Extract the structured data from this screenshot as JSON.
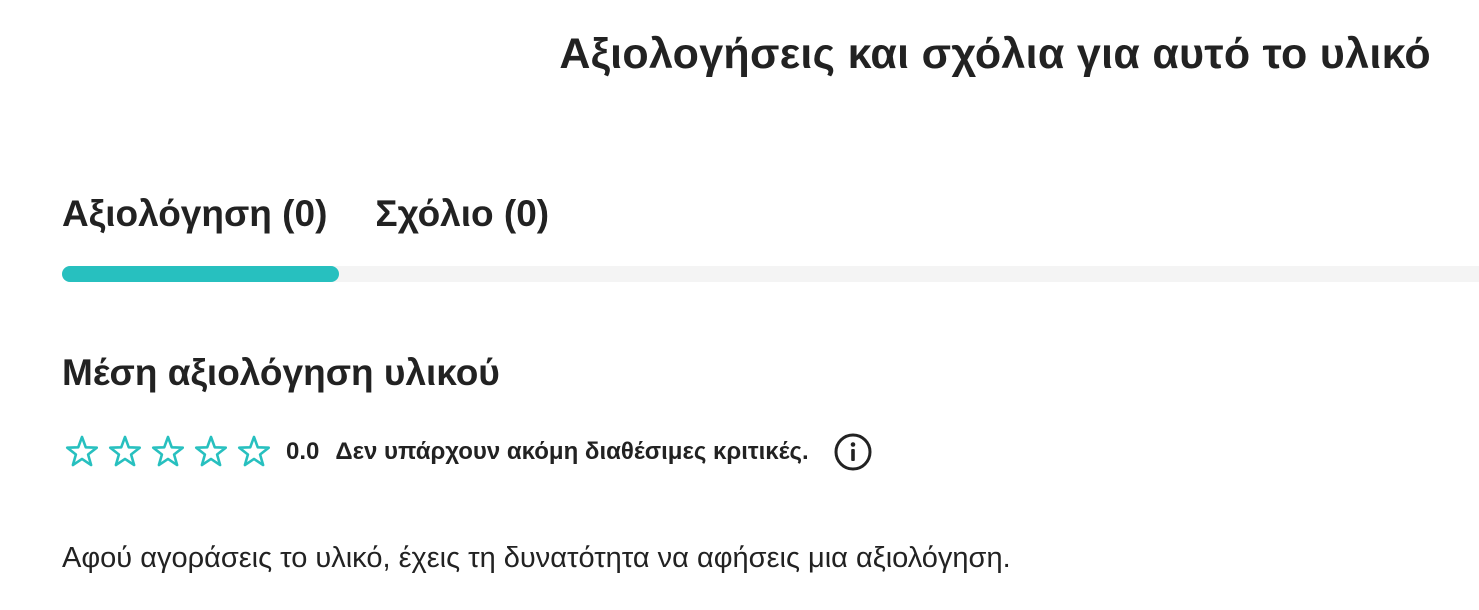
{
  "header": {
    "title": "Αξιολογήσεις και σχόλια για αυτό το υλικό"
  },
  "tabs": [
    {
      "label": "Αξιολόγηση (0)",
      "active": true
    },
    {
      "label": "Σχόλιο (0)",
      "active": false
    }
  ],
  "rating": {
    "section_title": "Μέση αξιολόγηση υλικού",
    "value": "0.0",
    "stars_filled": 0,
    "stars_total": 5,
    "status_text": "Δεν υπάρχουν ακόμη διαθέσιμες κριτικές.",
    "info_icon": "info-icon"
  },
  "notice": "Αφού αγοράσεις το υλικό, έχεις τη δυνατότητα να αφήσεις μια αξιολόγηση.",
  "colors": {
    "accent": "#27c0bf",
    "text": "#222222",
    "track": "#f4f4f4"
  }
}
